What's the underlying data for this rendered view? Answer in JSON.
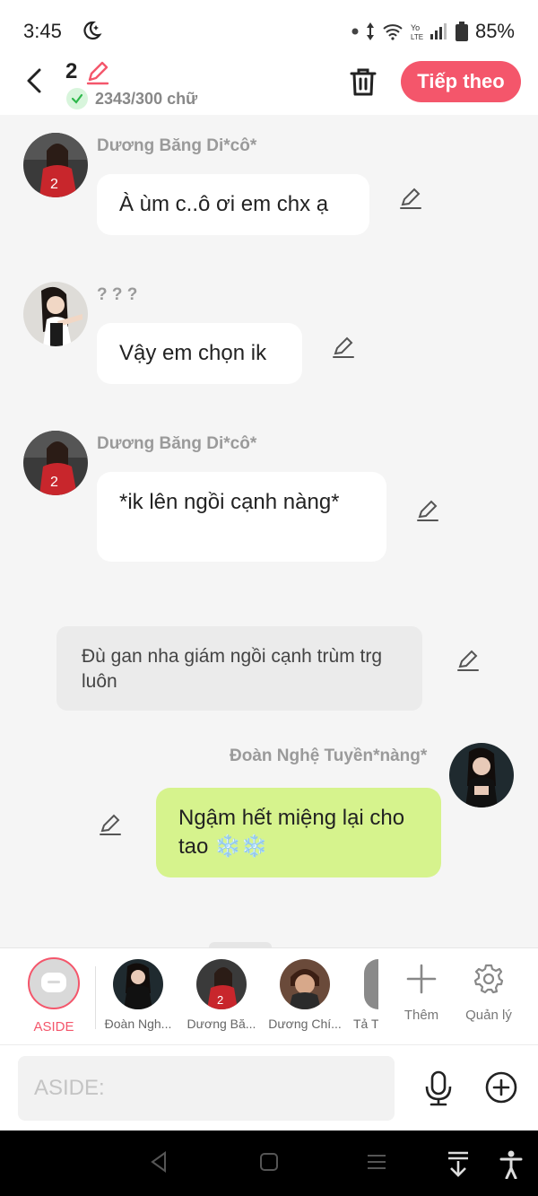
{
  "status_bar": {
    "time": "3:45",
    "battery": "85%"
  },
  "header": {
    "chapter_number": "2",
    "word_count": "2343/300 chữ",
    "next_label": "Tiếp theo"
  },
  "messages": [
    {
      "sender": "Dương Băng Di*cô*",
      "text": "À ùm c..ô ơi em chx ạ"
    },
    {
      "sender": "? ? ?",
      "text": "Vậy em chọn ik"
    },
    {
      "sender": "Dương Băng Di*cô*",
      "text": "*ik lên ngồi cạnh nàng*"
    },
    {
      "aside": "Đù gan nha giám ngồi cạnh trùm trg luôn"
    },
    {
      "sender": "Đoàn Nghệ Tuyền*nàng*",
      "text": "Ngậm hết miệng lại cho tao ❄️❄️"
    }
  ],
  "character_bar": {
    "aside_label": "ASIDE",
    "characters": [
      {
        "name": "Đoàn Ngh..."
      },
      {
        "name": "Dương Bă..."
      },
      {
        "name": "Dương Chí..."
      },
      {
        "name": "Tả T"
      }
    ],
    "add_label": "Thêm",
    "manage_label": "Quản lý"
  },
  "input": {
    "placeholder": "ASIDE:"
  },
  "colors": {
    "accent": "#f4566b",
    "green_bubble": "#d6f38d",
    "background": "#f5f5f5"
  }
}
